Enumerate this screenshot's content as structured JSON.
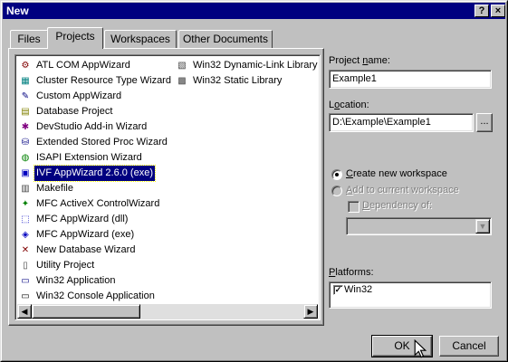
{
  "window": {
    "title": "New",
    "help_btn": "?",
    "close_btn": "×"
  },
  "tabs": [
    {
      "label": "Files"
    },
    {
      "label": "Projects"
    },
    {
      "label": "Workspaces"
    },
    {
      "label": "Other Documents"
    }
  ],
  "project_list": {
    "column1": [
      {
        "label": "ATL COM AppWizard",
        "icon": "atl-icon"
      },
      {
        "label": "Cluster Resource Type Wizard",
        "icon": "cluster-icon"
      },
      {
        "label": "Custom AppWizard",
        "icon": "custom-wizard-icon"
      },
      {
        "label": "Database Project",
        "icon": "database-icon"
      },
      {
        "label": "DevStudio Add-in Wizard",
        "icon": "addin-icon"
      },
      {
        "label": "Extended Stored Proc Wizard",
        "icon": "stored-proc-icon"
      },
      {
        "label": "ISAPI Extension Wizard",
        "icon": "globe-icon"
      },
      {
        "label": "IVF AppWizard 2.6.0 (exe)",
        "icon": "ivf-icon"
      },
      {
        "label": "Makefile",
        "icon": "makefile-icon"
      },
      {
        "label": "MFC ActiveX ControlWizard",
        "icon": "activex-icon"
      },
      {
        "label": "MFC AppWizard (dll)",
        "icon": "mfc-dll-icon"
      },
      {
        "label": "MFC AppWizard (exe)",
        "icon": "mfc-exe-icon"
      },
      {
        "label": "New Database Wizard",
        "icon": "new-db-icon"
      },
      {
        "label": "Utility Project",
        "icon": "utility-icon"
      },
      {
        "label": "Win32 Application",
        "icon": "win32-app-icon"
      },
      {
        "label": "Win32 Console Application",
        "icon": "console-icon"
      }
    ],
    "column2": [
      {
        "label": "Win32 Dynamic-Link Library",
        "icon": "dll-icon"
      },
      {
        "label": "Win32 Static Library",
        "icon": "lib-icon"
      }
    ],
    "selected": "IVF AppWizard 2.6.0 (exe)"
  },
  "project_name": {
    "label_pre": "Project ",
    "label_ul": "n",
    "label_post": "ame:",
    "value": "Example1"
  },
  "location": {
    "label_pre": "L",
    "label_ul": "o",
    "label_post": "cation:",
    "value": "D:\\Example\\Example1",
    "browse": "..."
  },
  "workspace": {
    "create": {
      "label_pre": "",
      "label_ul": "C",
      "label_post": "reate new workspace",
      "checked": true
    },
    "add": {
      "label_pre": "",
      "label_ul": "A",
      "label_post": "dd to current workspace",
      "checked": false
    },
    "dependency": {
      "label_pre": "",
      "label_ul": "D",
      "label_post": "ependency of:"
    }
  },
  "platforms": {
    "label_pre": "",
    "label_ul": "P",
    "label_post": "latforms:",
    "items": [
      {
        "label": "Win32",
        "checked": true
      }
    ]
  },
  "buttons": {
    "ok": "OK",
    "cancel": "Cancel"
  }
}
